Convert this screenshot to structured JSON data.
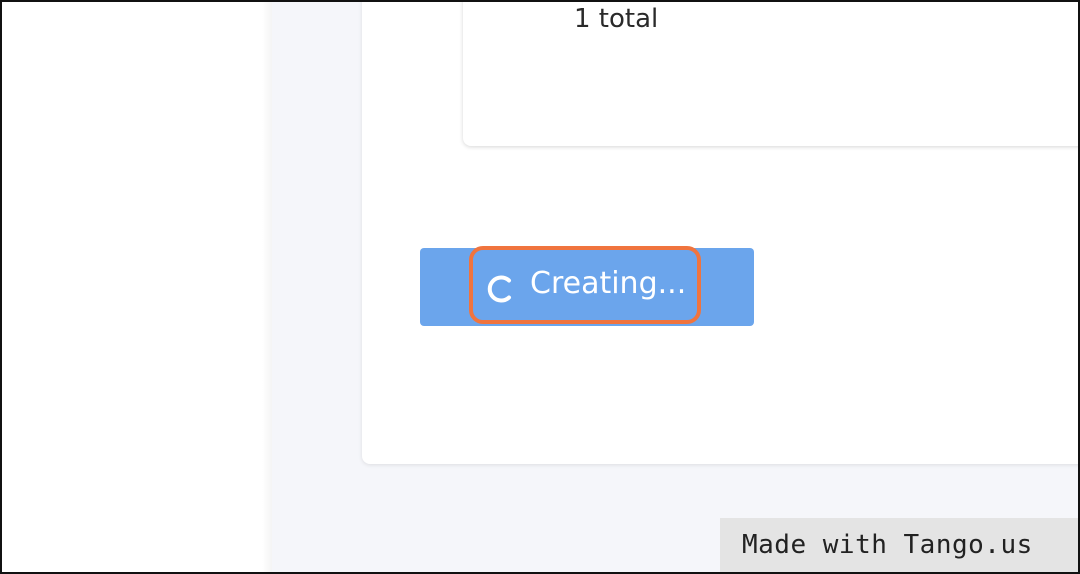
{
  "summary": {
    "total_text": "1 total"
  },
  "create_button": {
    "label": "Creating...",
    "state_icon": "spinner-icon",
    "background_color": "#6ba5ec",
    "highlight_color": "#f0743e"
  },
  "watermark": {
    "text": "Made with Tango.us"
  }
}
